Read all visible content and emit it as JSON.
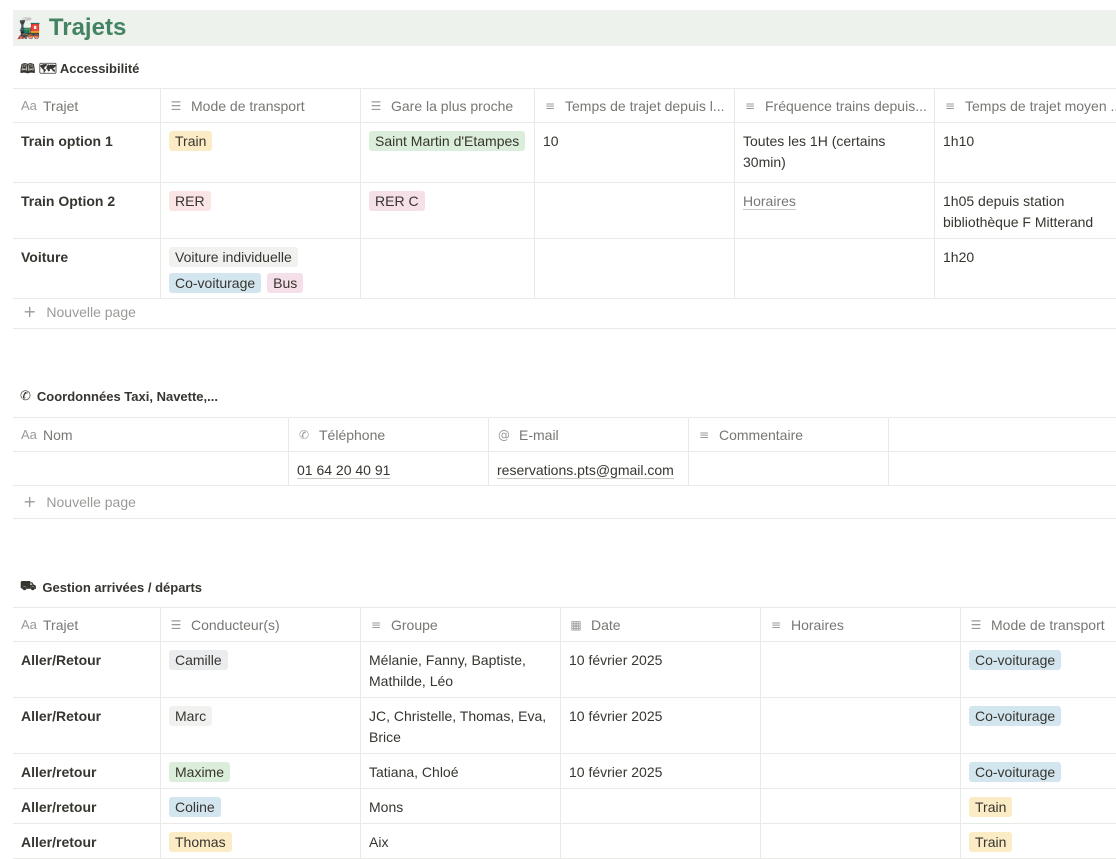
{
  "page": {
    "title": "Trajets",
    "emoji": "🚂"
  },
  "colors": {
    "yellow": "#fbecc6",
    "red": "#fbe4e4",
    "green": "#dbeddb",
    "blue": "#d3e5ef",
    "gray": "#ebeced",
    "pink": "#f5e0e9",
    "brown": "#eee0da",
    "default": "#f1f1ef"
  },
  "section1": {
    "title": "🕮 🗺 Accessibilité",
    "headers": [
      {
        "icon": "Aa",
        "label": "Trajet"
      },
      {
        "icon": "☰",
        "label": "Mode de transport"
      },
      {
        "icon": "☰",
        "label": "Gare la plus proche"
      },
      {
        "icon": "≡",
        "label": "Temps de trajet depuis l..."
      },
      {
        "icon": "≡",
        "label": "Fréquence trains depuis..."
      },
      {
        "icon": "≡",
        "label": "Temps de trajet moyen ..."
      }
    ],
    "rows": [
      {
        "trajet": "Train option 1",
        "modes": [
          {
            "label": "Train",
            "color": "#fbecc6"
          }
        ],
        "gares": [
          {
            "label": "Saint Martin d'Etampes",
            "color": "#dbeddb"
          }
        ],
        "temps": "10",
        "frequence": "Toutes les 1H (certains 30min)",
        "moyen": "1h10"
      },
      {
        "trajet": "Train Option 2",
        "modes": [
          {
            "label": "RER",
            "color": "#fbe4e4"
          }
        ],
        "gares": [
          {
            "label": "RER C",
            "color": "#f5e0e9"
          }
        ],
        "temps": "",
        "frequence": "Horaires",
        "moyen": "1h05 depuis station bibliothèque F Mitterand"
      },
      {
        "trajet": "Voiture",
        "modes": [
          {
            "label": "Voiture individuelle",
            "color": "#f1f1ef"
          },
          {
            "label": "Co-voiturage",
            "color": "#d3e5ef"
          },
          {
            "label": "Bus",
            "color": "#f5e0e9"
          }
        ],
        "gares": [],
        "temps": "",
        "frequence": "",
        "moyen": "1h20"
      }
    ],
    "new_page": "Nouvelle page"
  },
  "section2": {
    "title": "Coordonnées Taxi, Navette,...",
    "headers": [
      {
        "icon": "Aa",
        "label": "Nom"
      },
      {
        "icon": "✆",
        "label": "Téléphone"
      },
      {
        "icon": "@",
        "label": "E-mail"
      },
      {
        "icon": "≡",
        "label": "Commentaire"
      },
      {
        "icon": "",
        "label": ""
      }
    ],
    "rows": [
      {
        "nom": "",
        "telephone": "01 64 20 40 91",
        "email": "reservations.pts@gmail.com",
        "commentaire": ""
      }
    ],
    "new_page": "Nouvelle page"
  },
  "section3": {
    "title": "Gestion arrivées / départs",
    "headers": [
      {
        "icon": "Aa",
        "label": "Trajet"
      },
      {
        "icon": "☰",
        "label": "Conducteur(s)"
      },
      {
        "icon": "≡",
        "label": "Groupe"
      },
      {
        "icon": "▦",
        "label": "Date"
      },
      {
        "icon": "≡",
        "label": "Horaires"
      },
      {
        "icon": "☰",
        "label": "Mode de transport"
      }
    ],
    "rows": [
      {
        "trajet": "Aller/Retour",
        "conducteur": {
          "label": "Camille",
          "color": "#ebeced"
        },
        "groupe": "Mélanie, Fanny, Baptiste, Mathilde, Léo",
        "date": "10 février 2025",
        "horaires": "",
        "mode": {
          "label": "Co-voiturage",
          "color": "#d3e5ef"
        }
      },
      {
        "trajet": "Aller/Retour",
        "conducteur": {
          "label": "Marc",
          "color": "#f1f1ef"
        },
        "groupe": "JC, Christelle, Thomas, Eva, Brice",
        "date": "10 février 2025",
        "horaires": "",
        "mode": {
          "label": "Co-voiturage",
          "color": "#d3e5ef"
        }
      },
      {
        "trajet": "Aller/retour",
        "conducteur": {
          "label": "Maxime",
          "color": "#dbeddb"
        },
        "groupe": "Tatiana, Chloé",
        "date": "10 février 2025",
        "horaires": "",
        "mode": {
          "label": "Co-voiturage",
          "color": "#d3e5ef"
        }
      },
      {
        "trajet": "Aller/retour",
        "conducteur": {
          "label": "Coline",
          "color": "#d3e5ef"
        },
        "groupe": "Mons",
        "date": "",
        "horaires": "",
        "mode": {
          "label": "Train",
          "color": "#fbecc6"
        }
      },
      {
        "trajet": "Aller/retour",
        "conducteur": {
          "label": "Thomas",
          "color": "#fbecc6"
        },
        "groupe": "Aix",
        "date": "",
        "horaires": "",
        "mode": {
          "label": "Train",
          "color": "#fbecc6"
        }
      }
    ]
  }
}
